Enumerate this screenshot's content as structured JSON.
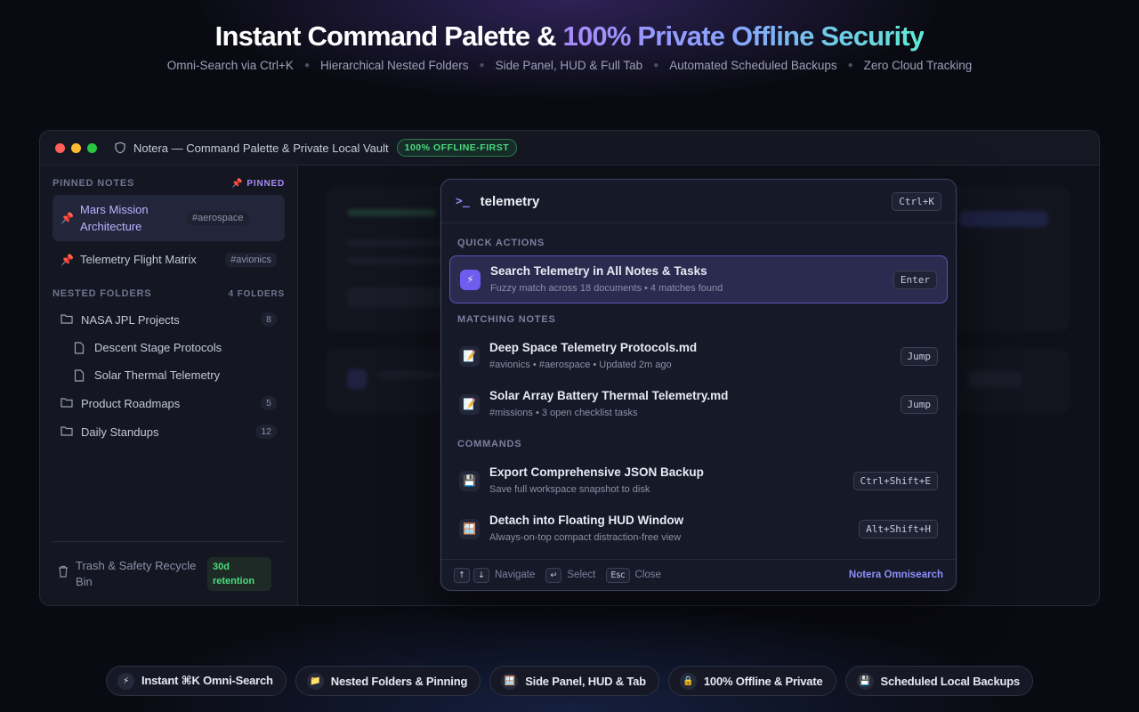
{
  "hero": {
    "title_main": "Instant Command Palette & ",
    "title_grad": "100% Private Offline Security",
    "features": [
      "Omni-Search via Ctrl+K",
      "Hierarchical Nested Folders",
      "Side Panel, HUD & Full Tab",
      "Automated Scheduled Backups",
      "Zero Cloud Tracking"
    ]
  },
  "window": {
    "title": "Notera — Command Palette & Private Local Vault",
    "badge": "100% OFFLINE-FIRST"
  },
  "sidebar": {
    "pinned_header": "PINNED NOTES",
    "pinned_flag": "PINNED",
    "pinned": [
      {
        "label": "Mars Mission Architecture",
        "tag": "#aerospace"
      },
      {
        "label": "Telemetry Flight Matrix",
        "tag": "#avionics"
      }
    ],
    "folders_header": "NESTED FOLDERS",
    "folders_count": "4 FOLDERS",
    "folders": [
      {
        "label": "NASA JPL Projects",
        "count": "8"
      },
      {
        "label": "Descent Stage Protocols"
      },
      {
        "label": "Solar Thermal Telemetry"
      },
      {
        "label": "Product Roadmaps",
        "count": "5"
      },
      {
        "label": "Daily Standups",
        "count": "12"
      }
    ],
    "trash_label": "Trash & Safety Recycle Bin",
    "trash_retention": "30d retention"
  },
  "palette": {
    "query": "telemetry",
    "shortcut": "Ctrl+K",
    "quick_actions_header": "QUICK ACTIONS",
    "quick_action": {
      "title": "Search Telemetry in All Notes & Tasks",
      "sub": "Fuzzy match across 18 documents • 4 matches found",
      "key": "Enter"
    },
    "notes_header": "MATCHING NOTES",
    "notes": [
      {
        "title": "Deep Space Telemetry Protocols.md",
        "sub": "#avionics • #aerospace • Updated 2m ago",
        "key": "Jump"
      },
      {
        "title": "Solar Array Battery Thermal Telemetry.md",
        "sub": "#missions • 3 open checklist tasks",
        "key": "Jump"
      }
    ],
    "commands_header": "COMMANDS",
    "commands": [
      {
        "title": "Export Comprehensive JSON Backup",
        "sub": "Save full workspace snapshot to disk",
        "key": "Ctrl+Shift+E"
      },
      {
        "title": "Detach into Floating HUD Window",
        "sub": "Always-on-top compact distraction-free view",
        "key": "Alt+Shift+H"
      }
    ],
    "footer": {
      "navigate": "Navigate",
      "select": "Select",
      "esc": "Esc",
      "close": "Close",
      "brand": "Notera Omnisearch"
    }
  },
  "pills": [
    {
      "label": "Instant ⌘K Omni-Search",
      "icon": "lightning-icon"
    },
    {
      "label": "Nested Folders & Pinning",
      "icon": "folder-icon"
    },
    {
      "label": "Side Panel, HUD & Tab",
      "icon": "window-icon"
    },
    {
      "label": "100% Offline & Private",
      "icon": "lock-icon"
    },
    {
      "label": "Scheduled Local Backups",
      "icon": "floppy-icon"
    }
  ]
}
